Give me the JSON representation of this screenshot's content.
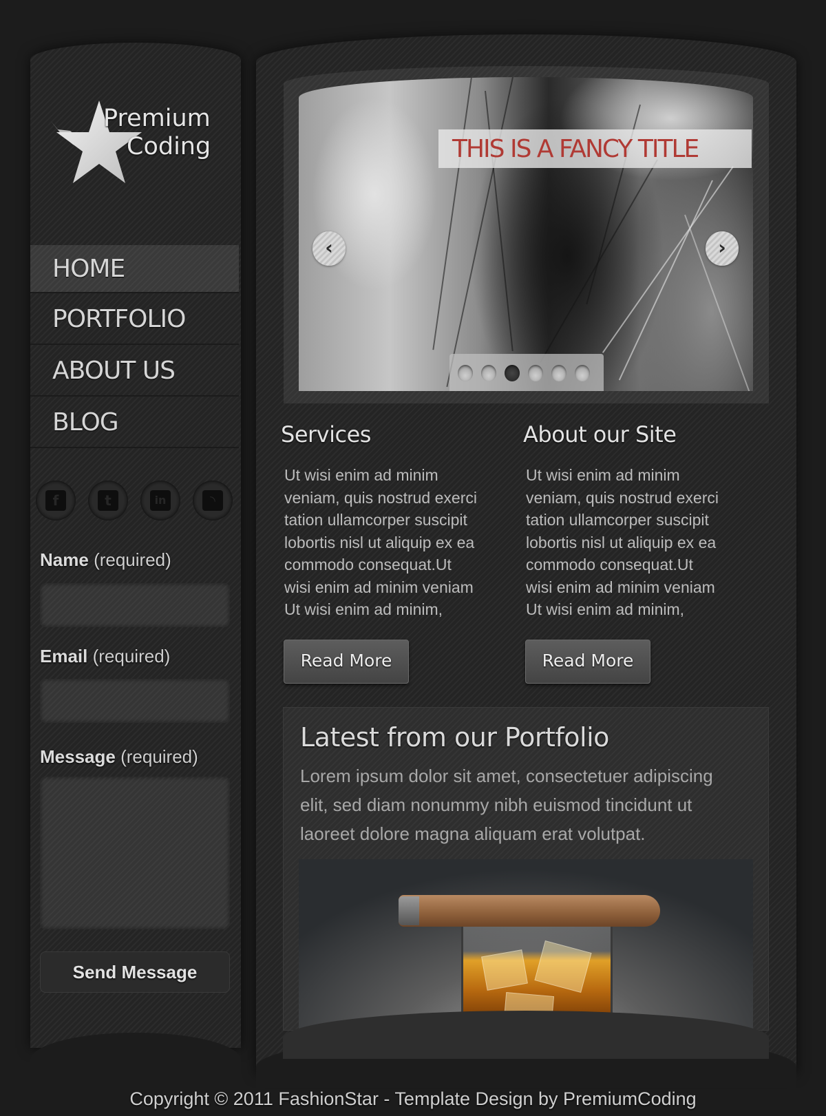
{
  "brand": {
    "logo_icon": "star-logo-icon",
    "line1": "Premium",
    "line2": "Coding"
  },
  "nav": {
    "items": [
      {
        "label": "HOME",
        "active": true
      },
      {
        "label": "PORTFOLIO",
        "active": false
      },
      {
        "label": "ABOUT US",
        "active": false
      },
      {
        "label": "BLOG",
        "active": false
      }
    ]
  },
  "social": [
    {
      "icon": "facebook-icon",
      "glyph": "f"
    },
    {
      "icon": "twitter-icon",
      "glyph": "t"
    },
    {
      "icon": "linkedin-icon",
      "glyph": "in"
    },
    {
      "icon": "rss-icon",
      "glyph": "◝"
    }
  ],
  "contact_form": {
    "name_label": "Name",
    "email_label": "Email",
    "message_label": "Message",
    "required_suffix": "(required)",
    "name_value": "",
    "email_value": "",
    "message_value": "",
    "send_label": "Send Message"
  },
  "slider": {
    "title": "THIS IS A FANCY TITLE",
    "prev_glyph": "‹",
    "next_glyph": "›",
    "slide_count": 6,
    "active_slide": 3,
    "title_color": "#b03a34"
  },
  "services": {
    "title": "Services",
    "lines": [
      "Ut wisi enim ad minim",
      "veniam, quis nostrud exerci",
      "tation ullamcorper suscipit",
      "lobortis nisl ut aliquip ex ea",
      "commodo consequat.Ut",
      "wisi enim ad minim veniam",
      "Ut wisi enim ad minim,"
    ],
    "button": "Read More"
  },
  "about": {
    "title": "About our Site",
    "lines": [
      "Ut wisi enim ad minim",
      "veniam, quis nostrud exerci",
      "tation ullamcorper suscipit",
      "lobortis nisl ut aliquip ex ea",
      "commodo consequat.Ut",
      "wisi enim ad minim veniam",
      "Ut wisi enim ad minim,"
    ],
    "button": "Read More"
  },
  "portfolio": {
    "title": "Latest from our Portfolio",
    "lines": [
      "Lorem ipsum dolor sit amet, consectetuer adipiscing",
      "elit, sed diam nonummy nibh euismod tincidunt ut",
      "laoreet dolore magna aliquam erat volutpat."
    ]
  },
  "footer": {
    "text": "Copyright © 2011 FashionStar - Template Design by PremiumCoding"
  }
}
